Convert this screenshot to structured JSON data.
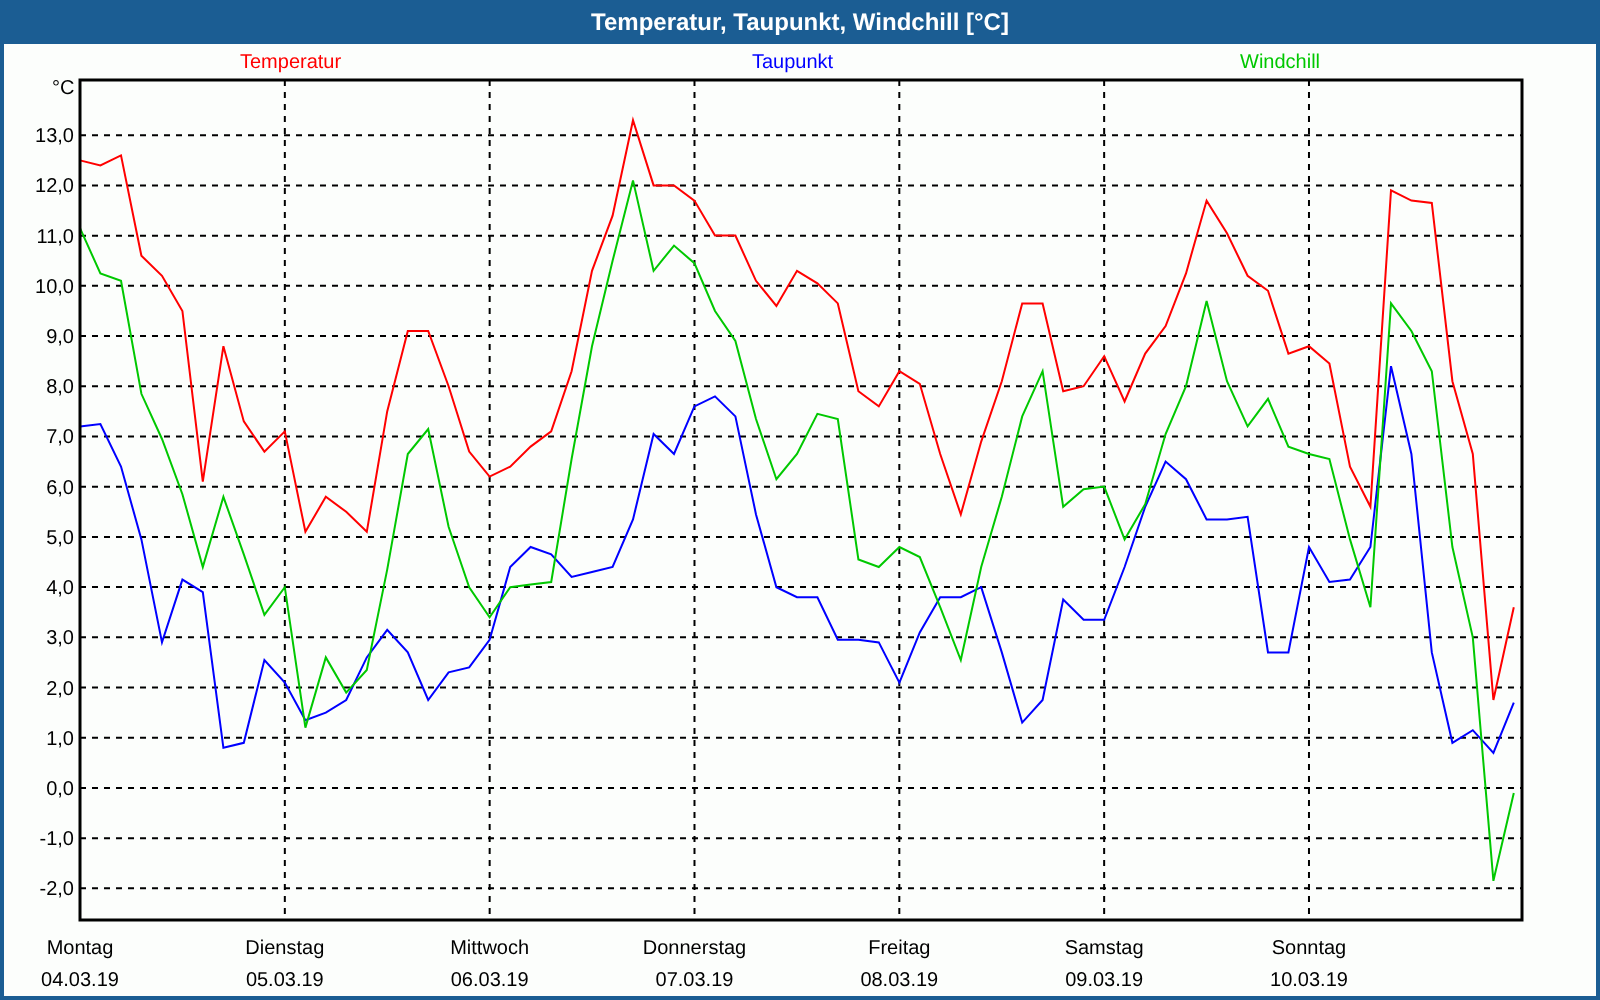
{
  "window": {
    "title": "Temperatur, Taupunkt, Windchill [°C]"
  },
  "chart": {
    "date_labels": [
      "04.03.19",
      "05.03.19",
      "06.03.19",
      "07.03.19",
      "08.03.19",
      "09.03.19",
      "10.03.19"
    ],
    "chart_data": {
      "type": "line",
      "ylabel": "°C",
      "categories": [
        "Montag",
        null,
        null,
        null,
        null,
        null,
        null,
        null,
        null,
        null,
        "Dienstag",
        null,
        null,
        null,
        null,
        null,
        null,
        null,
        null,
        null,
        "Mittwoch",
        null,
        null,
        null,
        null,
        null,
        null,
        null,
        null,
        null,
        "Donnerstag",
        null,
        null,
        null,
        null,
        null,
        null,
        null,
        null,
        null,
        "Freitag",
        null,
        null,
        null,
        null,
        null,
        null,
        null,
        null,
        null,
        "Samstag",
        null,
        null,
        null,
        null,
        null,
        null,
        null,
        null,
        null,
        "Sonntag",
        null,
        null,
        null,
        null,
        null,
        null,
        null,
        null,
        null,
        null
      ],
      "series": [
        {
          "name": "Temperatur",
          "color": "#ff0000",
          "values": [
            12.5,
            12.4,
            12.6,
            10.6,
            10.2,
            9.5,
            6.1,
            8.8,
            7.3,
            6.7,
            7.1,
            5.1,
            5.8,
            5.5,
            5.1,
            7.5,
            9.1,
            9.1,
            8.0,
            6.7,
            6.2,
            6.4,
            6.8,
            7.1,
            8.3,
            10.3,
            11.4,
            13.3,
            12.0,
            12.0,
            11.7,
            11.0,
            11.0,
            10.1,
            9.6,
            10.3,
            10.05,
            9.65,
            7.9,
            7.6,
            8.3,
            8.05,
            6.65,
            5.45,
            6.9,
            8.1,
            9.65,
            9.65,
            7.9,
            8.0,
            8.6,
            7.7,
            8.65,
            9.2,
            10.25,
            11.7,
            11.05,
            10.2,
            9.9,
            8.65,
            8.8,
            8.45,
            6.4,
            5.6,
            11.9,
            11.7,
            11.65,
            8.1,
            6.65,
            1.75,
            3.6
          ]
        },
        {
          "name": "Taupunkt",
          "color": "#0000ff",
          "values": [
            7.2,
            7.25,
            6.4,
            4.95,
            2.9,
            4.15,
            3.9,
            0.8,
            0.9,
            2.55,
            2.1,
            1.35,
            1.5,
            1.75,
            2.6,
            3.15,
            2.7,
            1.75,
            2.3,
            2.4,
            2.95,
            4.4,
            4.8,
            4.65,
            4.2,
            4.3,
            4.4,
            5.35,
            7.05,
            6.65,
            7.6,
            7.8,
            7.4,
            5.45,
            4.0,
            3.8,
            3.8,
            2.95,
            2.95,
            2.9,
            2.1,
            3.1,
            3.8,
            3.8,
            4.0,
            2.7,
            1.3,
            1.75,
            3.75,
            3.35,
            3.35,
            4.4,
            5.6,
            6.5,
            6.15,
            5.35,
            5.35,
            5.4,
            2.7,
            2.7,
            4.8,
            4.1,
            4.15,
            4.8,
            8.4,
            6.65,
            2.7,
            0.9,
            1.15,
            0.7,
            1.7
          ]
        },
        {
          "name": "Windchill",
          "color": "#00c800",
          "values": [
            11.15,
            10.25,
            10.1,
            7.85,
            6.95,
            5.85,
            4.4,
            5.8,
            4.65,
            3.45,
            4.0,
            1.2,
            2.6,
            1.9,
            2.35,
            4.35,
            6.65,
            7.15,
            5.2,
            4.0,
            3.4,
            4.0,
            4.05,
            4.1,
            6.55,
            8.8,
            10.5,
            12.1,
            10.3,
            10.8,
            10.45,
            9.5,
            8.9,
            7.35,
            6.15,
            6.65,
            7.45,
            7.35,
            4.55,
            4.4,
            4.8,
            4.6,
            3.6,
            2.55,
            4.4,
            5.8,
            7.4,
            8.3,
            5.6,
            5.95,
            6.0,
            4.95,
            5.65,
            7.05,
            8.0,
            9.7,
            8.1,
            7.2,
            7.75,
            6.8,
            6.65,
            6.55,
            4.95,
            3.6,
            9.65,
            9.1,
            8.3,
            4.8,
            3.0,
            -1.85,
            -0.1
          ]
        }
      ],
      "ylim": [
        -2.63,
        14.1
      ],
      "grid": true,
      "yticks": [
        {
          "value": 13,
          "label": "13,0"
        },
        {
          "value": 12,
          "label": "12,0"
        },
        {
          "value": 11,
          "label": "11,0"
        },
        {
          "value": 10,
          "label": "10,0"
        },
        {
          "value": 9,
          "label": "9,0"
        },
        {
          "value": 8,
          "label": "8,0"
        },
        {
          "value": 7,
          "label": "7,0"
        },
        {
          "value": 6,
          "label": "6,0"
        },
        {
          "value": 5,
          "label": "5,0"
        },
        {
          "value": 4,
          "label": "4,0"
        },
        {
          "value": 3,
          "label": "3,0"
        },
        {
          "value": 2,
          "label": "2,0"
        },
        {
          "value": 1,
          "label": "1,0"
        },
        {
          "value": 0,
          "label": "0,0"
        },
        {
          "value": -1,
          "label": "-1,0"
        },
        {
          "value": -2,
          "label": "-2,0"
        }
      ]
    }
  }
}
